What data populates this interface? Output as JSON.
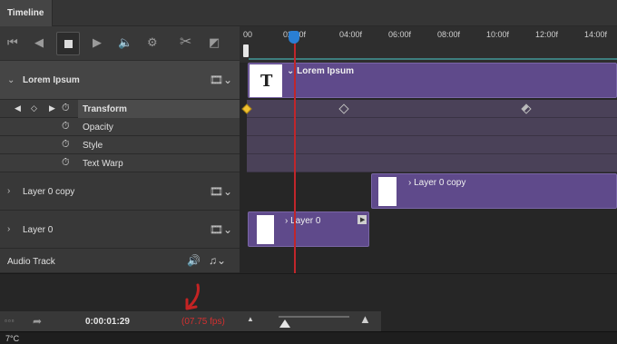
{
  "panel": {
    "tab_title": "Timeline"
  },
  "controls": {
    "first_frame": "⏮",
    "prev_frame": "◀",
    "next_frame": "▶",
    "volume": "🔈",
    "settings": "⚙",
    "split": "✂",
    "transition": "◩"
  },
  "ruler": {
    "ticks": [
      "00",
      "02:00f",
      "04:00f",
      "06:00f",
      "08:00f",
      "10:00f",
      "12:00f",
      "14:00f"
    ]
  },
  "layers": {
    "lorem": {
      "name": "Lorem Ipsum",
      "clip_label": "Lorem Ipsum",
      "thumb_text": "T"
    },
    "transform": {
      "name": "Transform"
    },
    "opacity": {
      "name": "Opacity"
    },
    "style": {
      "name": "Style"
    },
    "textwarp": {
      "name": "Text Warp"
    },
    "layer0copy": {
      "name": "Layer 0 copy",
      "clip_label": "Layer 0 copy"
    },
    "layer0": {
      "name": "Layer 0",
      "clip_label": "Layer 0"
    },
    "audio": {
      "name": "Audio Track"
    }
  },
  "status": {
    "timecode": "0:00:01:29",
    "fps": "(07.75 fps)",
    "fps_color": "#d23030",
    "accent": "#5f4a8b",
    "playhead_color": "#c0262b",
    "playhead_handle_color": "#2a7fd4"
  },
  "footer": {
    "text": "7°C"
  }
}
